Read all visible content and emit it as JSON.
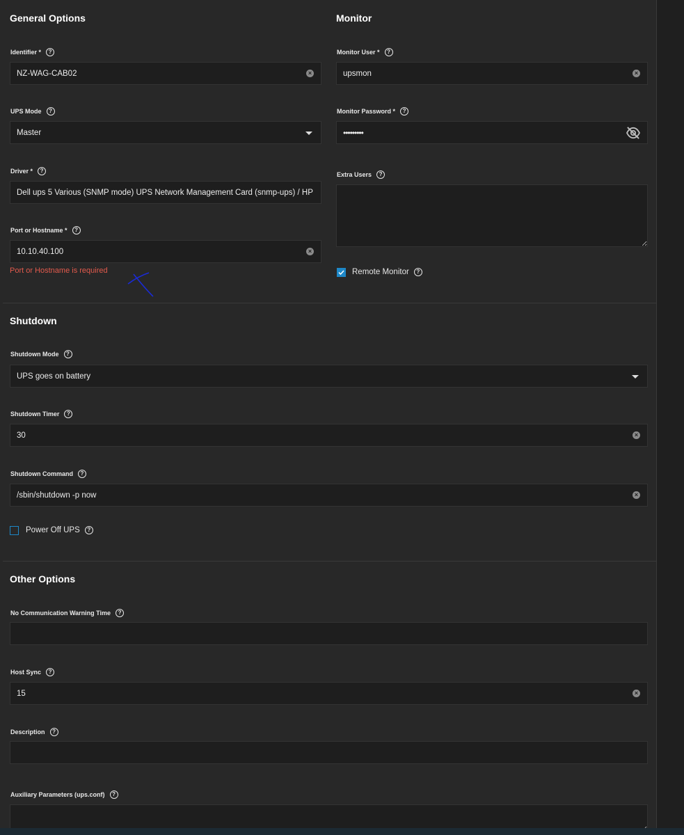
{
  "general": {
    "title": "General Options",
    "identifier_label": "Identifier *",
    "identifier_value": "NZ-WAG-CAB02",
    "ups_mode_label": "UPS Mode",
    "ups_mode_value": "Master",
    "driver_label": "Driver *",
    "driver_value": "Dell ups 5 Various (SNMP mode) UPS Network Management Card (snmp-ups) / HP",
    "port_label": "Port or Hostname *",
    "port_value": "10.10.40.100",
    "port_error": "Port or Hostname is required"
  },
  "monitor": {
    "title": "Monitor",
    "user_label": "Monitor User *",
    "user_value": "upsmon",
    "password_label": "Monitor Password *",
    "password_value": "•••••••••",
    "extra_users_label": "Extra Users",
    "extra_users_value": "",
    "remote_monitor_label": "Remote Monitor",
    "remote_monitor_checked": true
  },
  "shutdown": {
    "title": "Shutdown",
    "mode_label": "Shutdown Mode",
    "mode_value": "UPS goes on battery",
    "timer_label": "Shutdown Timer",
    "timer_value": "30",
    "command_label": "Shutdown Command",
    "command_value": "/sbin/shutdown -p now",
    "power_off_label": "Power Off UPS",
    "power_off_checked": false
  },
  "other": {
    "title": "Other Options",
    "nocomm_label": "No Communication Warning Time",
    "nocomm_value": "",
    "hostsync_label": "Host Sync",
    "hostsync_value": "15",
    "description_label": "Description",
    "description_value": "",
    "aux_label": "Auxiliary Parameters (ups.conf)",
    "aux_value": ""
  },
  "icons": {
    "help": "?",
    "clear": "×"
  },
  "colors": {
    "accent": "#1e88c8",
    "error": "#e35a4c",
    "annotation": "#1a2bd6"
  }
}
